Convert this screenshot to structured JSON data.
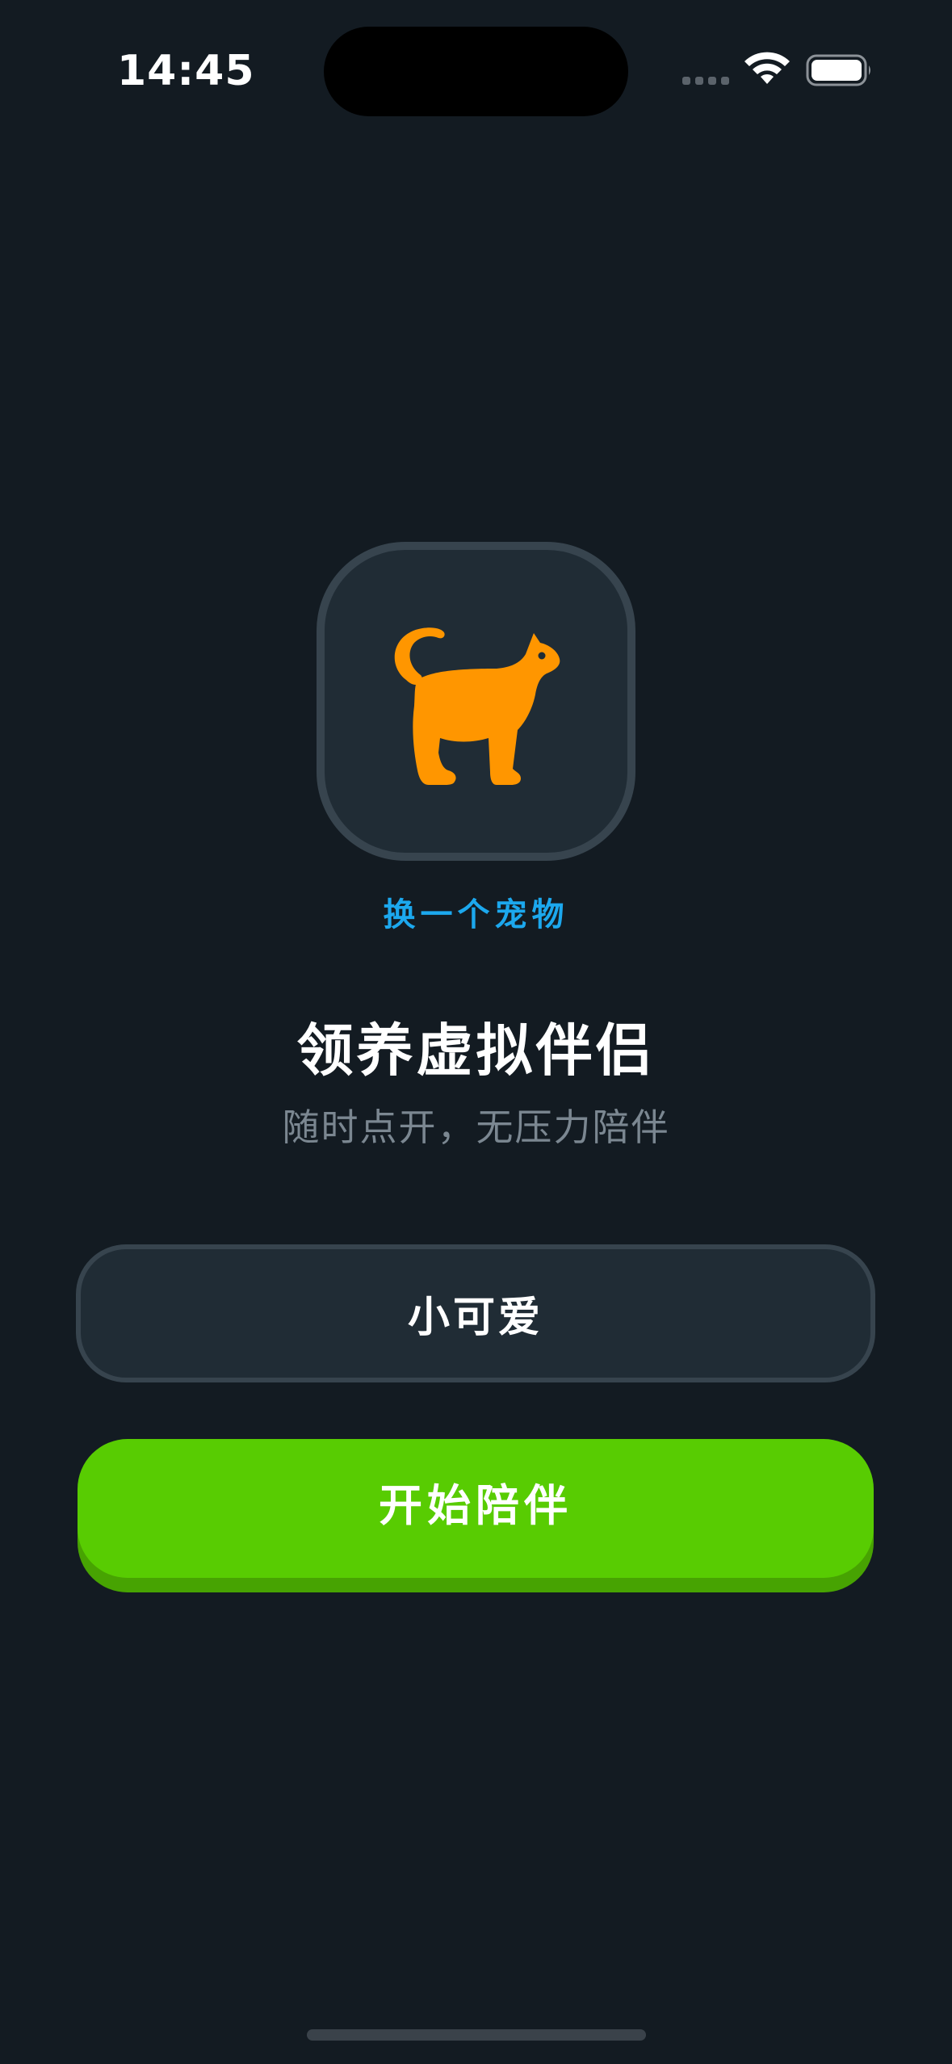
{
  "status_bar": {
    "time": "14:45",
    "icons": [
      "cellular-signal-icon",
      "wifi-icon",
      "battery-icon"
    ]
  },
  "pet": {
    "icon": "cat-icon",
    "icon_color": "#ff9600",
    "change_label": "换一个宠物"
  },
  "heading": {
    "title": "领养虚拟伴侣",
    "subtitle": "随时点开，无压力陪伴"
  },
  "name_field": {
    "value": "小可爱"
  },
  "actions": {
    "start_label": "开始陪伴"
  },
  "colors": {
    "background": "#131b22",
    "accent_link": "#1ca8ee",
    "primary_button": "#58cc02"
  }
}
